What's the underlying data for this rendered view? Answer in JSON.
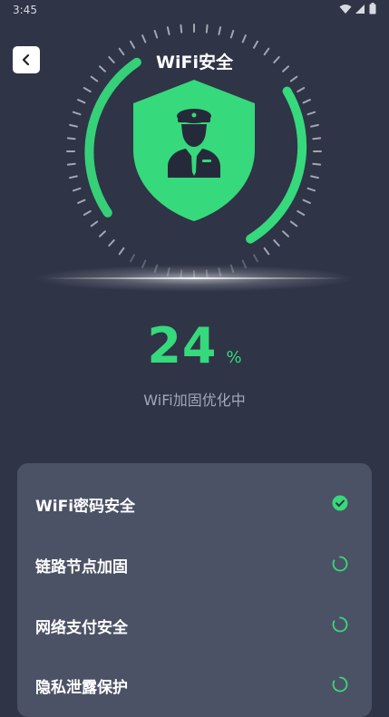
{
  "status_bar": {
    "time": "3:45"
  },
  "header": {
    "title": "WiFi安全"
  },
  "icons": {
    "back": "chevron-left-icon",
    "shield": "police-shield-icon",
    "done": "check-circle-icon",
    "pending": "loading-spinner-icon"
  },
  "colors": {
    "background": "#2f3447",
    "accent": "#36d97b",
    "card": "#4c5266",
    "muted_text": "#a3a8b7"
  },
  "progress": {
    "value": "24",
    "unit": "%",
    "status": "WiFi加固优化中"
  },
  "tasks": [
    {
      "label": "WiFi密码安全",
      "state": "done"
    },
    {
      "label": "链路节点加固",
      "state": "pending"
    },
    {
      "label": "网络支付安全",
      "state": "pending"
    },
    {
      "label": "隐私泄露保护",
      "state": "pending"
    }
  ]
}
